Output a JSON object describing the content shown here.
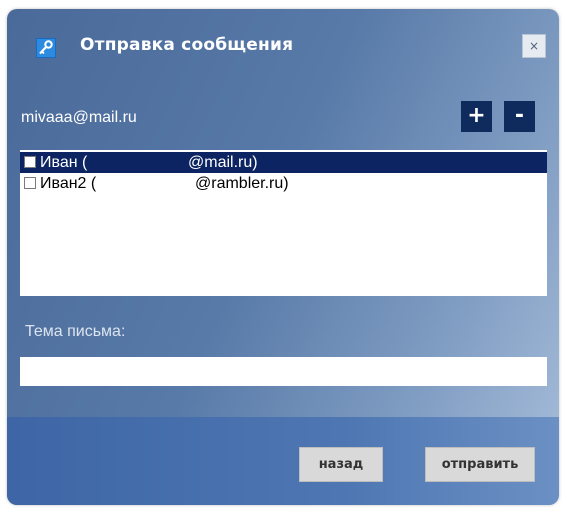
{
  "dialog": {
    "title": "Отправка сообщения",
    "close_label": "×"
  },
  "account": {
    "email": "mivaaa@mail.ru",
    "add_label": "+",
    "remove_label": "-"
  },
  "contacts": [
    {
      "name": "Иван (",
      "domain": "@mail.ru)",
      "selected": true,
      "checked": false
    },
    {
      "name": "Иван2 (",
      "domain": "@rambler.ru)",
      "selected": false,
      "checked": false
    }
  ],
  "subject": {
    "label": "Тема письма:",
    "value": ""
  },
  "footer": {
    "back_label": "назад",
    "send_label": "отправить"
  },
  "colors": {
    "selection": "#0c2461",
    "square_button": "#0f2a5c",
    "footer_bar": "#3e66a6"
  },
  "icons": {
    "title_icon": "key-icon"
  }
}
